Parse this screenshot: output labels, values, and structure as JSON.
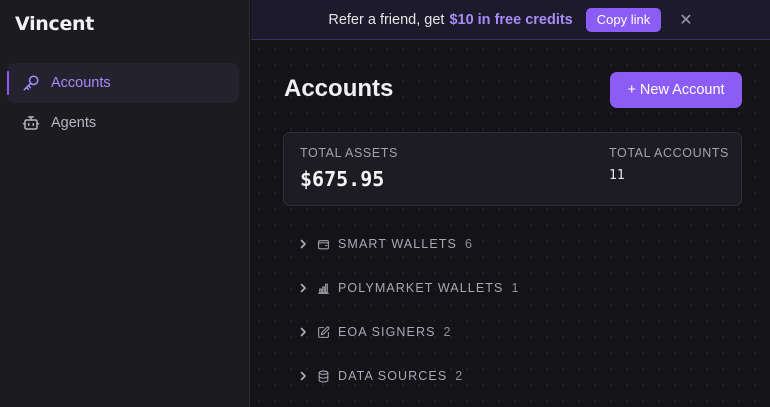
{
  "app": {
    "logo_text": "Vincent"
  },
  "sidebar": {
    "items": [
      {
        "label": "Accounts",
        "icon": "key-icon",
        "active": true
      },
      {
        "label": "Agents",
        "icon": "robot-icon",
        "active": false
      }
    ]
  },
  "banner": {
    "text": "Refer a friend, get",
    "highlight": "$10 in free credits",
    "copy_label": "Copy link",
    "close_glyph": "✕"
  },
  "main": {
    "title": "Accounts",
    "new_account_label": "+ New Account",
    "summary": {
      "total_assets_label": "TOTAL ASSETS",
      "total_assets_value": "$675.95",
      "total_accounts_label": "TOTAL ACCOUNTS",
      "total_accounts_value": "11"
    },
    "groups": [
      {
        "label": "SMART WALLETS",
        "count": "6",
        "icon": "wallet-icon"
      },
      {
        "label": "POLYMARKET WALLETS",
        "count": "1",
        "icon": "bar-chart-icon"
      },
      {
        "label": "EOA SIGNERS",
        "count": "2",
        "icon": "edit-icon"
      },
      {
        "label": "DATA SOURCES",
        "count": "2",
        "icon": "database-icon"
      }
    ]
  },
  "colors": {
    "accent": "#8b5cf6",
    "accent_text": "#a78bfa",
    "sidebar_bg": "#1b1b20",
    "main_bg": "#131318"
  }
}
